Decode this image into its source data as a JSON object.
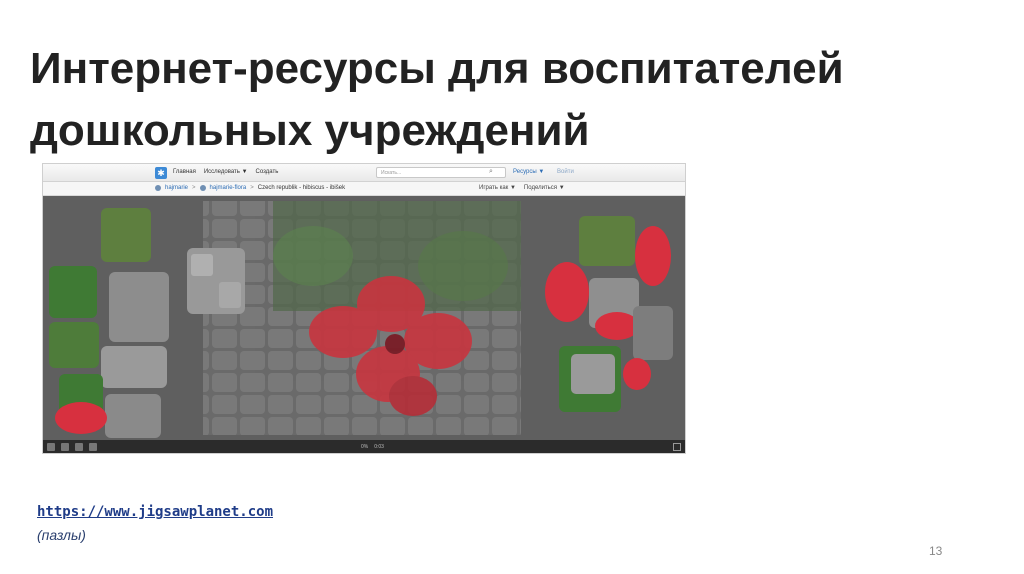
{
  "slide": {
    "title_line1": "Интернет-ресурсы для воспитателей",
    "title_line2": "дошкольных учреждений",
    "link": "https://www.jigsawplanet.com",
    "caption": "(пазлы)",
    "page_number": "13"
  },
  "site": {
    "nav": [
      "Главная",
      "Исследовать ▼",
      "Создать"
    ],
    "search_placeholder": "Искать...",
    "resources_label": "Ресурсы ▼",
    "signin_label": "Войти",
    "breadcrumbs": [
      "hajmarie",
      "hajmarie-flora",
      "Czech republik - hibiscus - ibišek"
    ],
    "actions": [
      "Играть как ▼",
      "Поделиться ▼"
    ],
    "status": [
      "0%",
      "0:03"
    ]
  },
  "colors": {
    "title": "#222222",
    "link": "#1f3c88",
    "board": "#5f5f5f",
    "flower": "#d7303f",
    "leaf": "#3f7a34"
  }
}
